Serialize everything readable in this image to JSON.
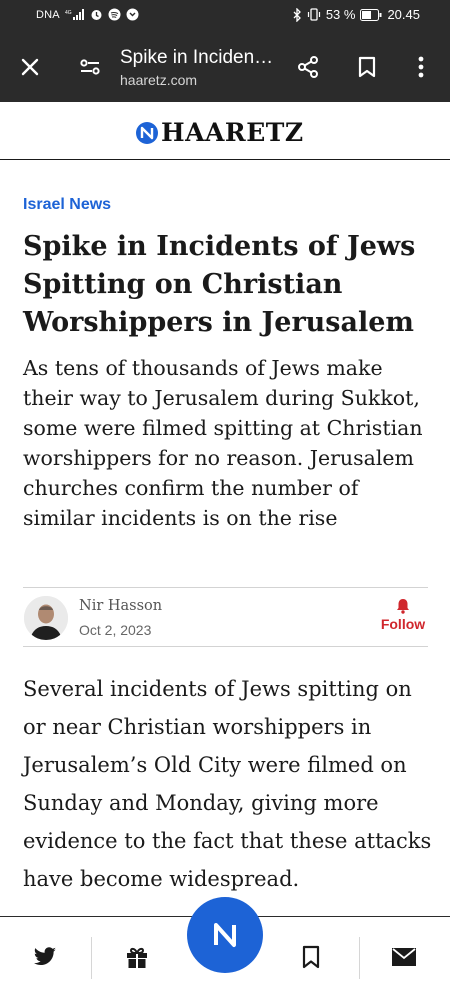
{
  "status_bar": {
    "carrier": "DNA",
    "network": "4G",
    "battery": "53 %",
    "time": "20.45"
  },
  "browser": {
    "page_title": "Spike in Inciden…",
    "url": "haaretz.com",
    "icons": [
      "close-icon",
      "tune-icon",
      "share-icon",
      "bookmark-icon",
      "more-icon"
    ]
  },
  "site": {
    "logo_text": "HAARETZ",
    "brand_color": "#1d63d6"
  },
  "article": {
    "section": "Israel News",
    "headline": "Spike in Incidents of Jews Spitting on Christian Worshippers in Jerusalem",
    "subheadline": "As tens of thousands of Jews make their way to Jerusalem during Sukkot, some were filmed spitting at Christian worshippers for no reason. Jerusalem churches confirm the number of similar incidents is on the rise",
    "author": "Nir Hasson",
    "date": "Oct 2, 2023",
    "follow_label": "Follow",
    "follow_color": "#d0272d",
    "body": "Several incidents of Jews spitting on or near Christian worshippers in Jerusalem’s Old City were filmed on Sunday and Monday, giving more evidence to the fact that these attacks have become widespread."
  },
  "bottom_bar": {
    "icons": [
      "twitter-icon",
      "gift-icon",
      "haaretz-logo-icon",
      "bookmark-icon",
      "mail-icon"
    ]
  }
}
